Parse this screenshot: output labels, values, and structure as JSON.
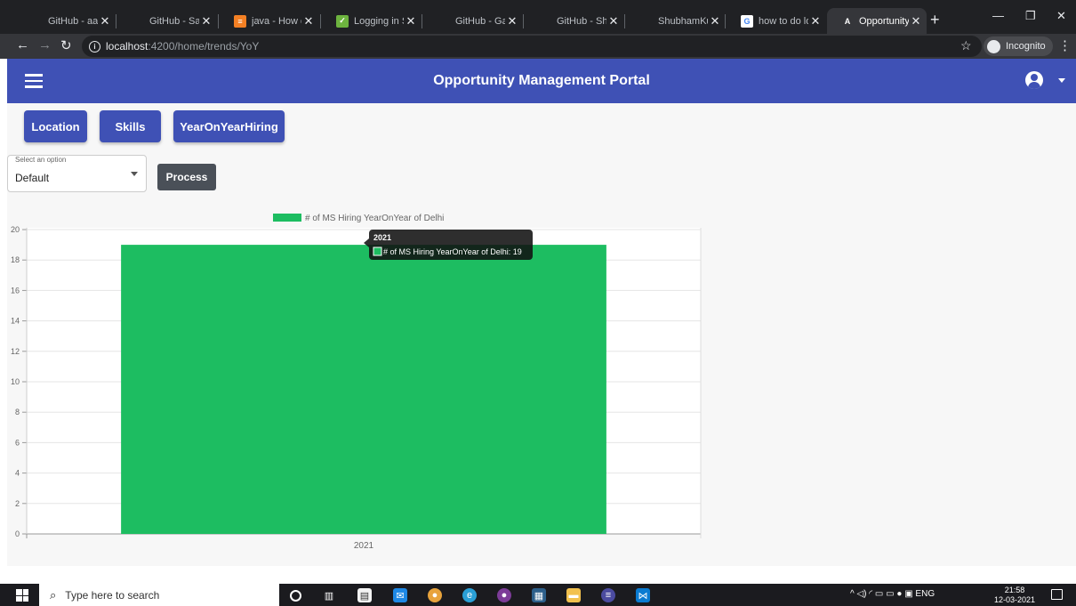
{
  "browser": {
    "tabs": [
      {
        "title": "GitHub - aagar",
        "favicon": "github-icon"
      },
      {
        "title": "GitHub - Sanya",
        "favicon": "github-icon"
      },
      {
        "title": "java - How do",
        "favicon": "stackoverflow-icon"
      },
      {
        "title": "Logging in Spr",
        "favicon": "spring-icon"
      },
      {
        "title": "GitHub - Gaura",
        "favicon": "github-icon"
      },
      {
        "title": "GitHub - Shubh",
        "favicon": "github-icon"
      },
      {
        "title": "ShubhamKuma",
        "favicon": "github-icon"
      },
      {
        "title": "how to do logg",
        "favicon": "google-icon"
      },
      {
        "title": "OpportunityMa",
        "favicon": "angular-icon",
        "active": true
      }
    ],
    "close_glyph": "✕",
    "new_tab_glyph": "+",
    "url_host": "localhost",
    "url_path": ":4200/home/trends/YoY",
    "incognito_label": "Incognito"
  },
  "app": {
    "title": "Opportunity Management Portal"
  },
  "nav": {
    "location": "Location",
    "skills": "Skills",
    "yoy": "YearOnYearHiring"
  },
  "select": {
    "label": "Select an option",
    "value": "Default"
  },
  "process_label": "Process",
  "chart_data": {
    "type": "bar",
    "categories": [
      "2021"
    ],
    "series": [
      {
        "name": "# of MS Hiring YearOnYear of Delhi",
        "values": [
          19
        ],
        "color": "#1dbd61"
      }
    ],
    "ylim": [
      0,
      20
    ],
    "yticks": [
      0,
      2,
      4,
      6,
      8,
      10,
      12,
      14,
      16,
      18,
      20
    ],
    "grid": true,
    "legend": "top",
    "tooltip": {
      "title": "2021",
      "label": "# of MS Hiring YearOnYear of Delhi: 19"
    }
  },
  "taskbar": {
    "search_placeholder": "Type here to search",
    "tray_lang": "ENG",
    "time": "21:58",
    "date": "12-03-2021"
  },
  "colors": {
    "appbar": "#3f51b5",
    "bar": "#1dbd61"
  }
}
